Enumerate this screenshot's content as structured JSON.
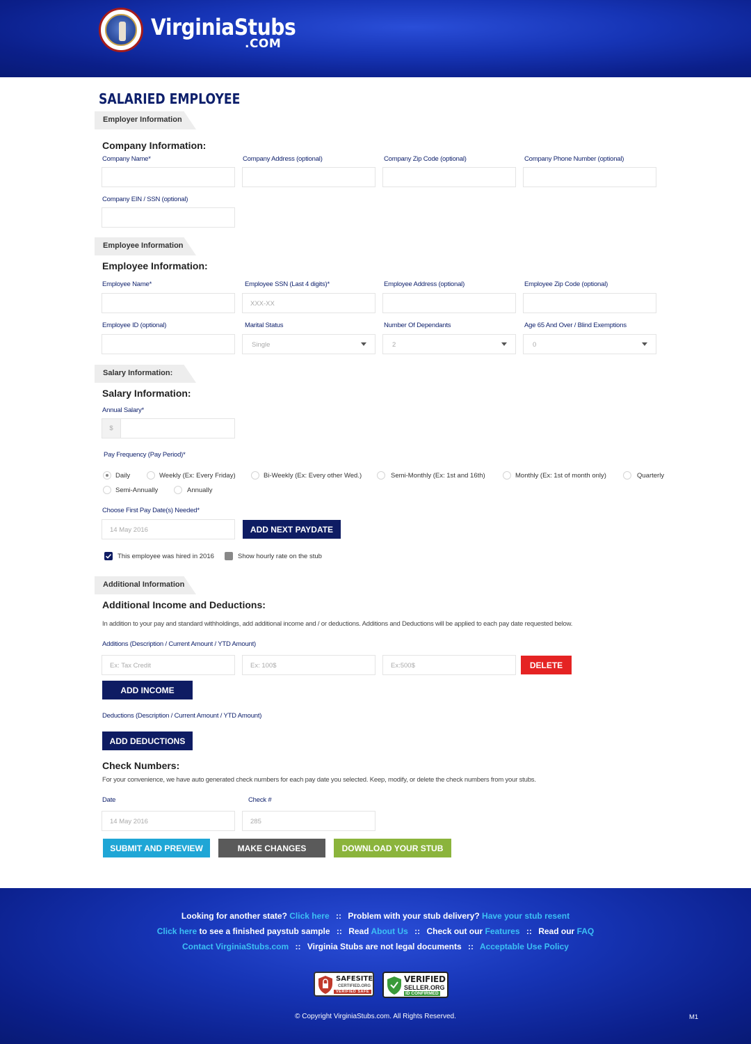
{
  "header": {
    "brand": "VirginiaStubs",
    "brand_suffix": ".COM"
  },
  "page_title": "SALARIED EMPLOYEE",
  "employer": {
    "tab": "Employer Information",
    "heading": "Company Information:",
    "company_name_label": "Company Name*",
    "company_address_label": "Company Address (optional)",
    "company_zip_label": "Company Zip Code (optional)",
    "company_phone_label": "Company Phone Number (optional)",
    "company_ein_label": "Company EIN / SSN (optional)"
  },
  "employee": {
    "tab": "Employee Information",
    "heading": "Employee Information:",
    "name_label": "Employee Name*",
    "ssn_label": "Employee SSN (Last 4 digits)*",
    "ssn_placeholder": "XXX-XX",
    "address_label": "Employee Address (optional)",
    "zip_label": "Employee Zip Code (optional)",
    "id_label": "Employee ID (optional)",
    "marital_label": "Marital Status",
    "marital_value": "Single",
    "dependants_label": "Number Of Dependants",
    "dependants_value": "2",
    "exemptions_label": "Age 65 And Over / Blind Exemptions",
    "exemptions_value": "0"
  },
  "salary": {
    "tab": "Salary Information:",
    "heading": "Salary Information:",
    "annual_label": "Annual Salary*",
    "currency": "$",
    "frequency_label": "Pay Frequency (Pay Period)*",
    "frequencies": [
      "Daily",
      "Weekly (Ex: Every Friday)",
      "Bi-Weekly (Ex: Every other Wed.)",
      "Semi-Monthly (Ex: 1st and 16th)",
      "Monthly (Ex: 1st of month only)",
      "Quarterly",
      "Semi-Annually",
      "Annually"
    ],
    "selected_frequency": "Daily",
    "first_pay_label": "Choose First Pay Date(s) Needed*",
    "first_pay_value": "14 May 2016",
    "add_paydate": "ADD NEXT PAYDATE",
    "hired_checkbox": "This employee was hired in 2016",
    "hired_checked": true,
    "hourly_checkbox": "Show hourly rate on the stub",
    "hourly_checked": false
  },
  "additional": {
    "tab": "Additional Information",
    "heading": "Additional Income and Deductions:",
    "description": "In addition to your pay and standard withholdings, add additional income and / or deductions. Additions and Deductions will be applied to each pay date requested below.",
    "additions_label": "Additions (Description / Current Amount / YTD Amount)",
    "desc_placeholder": "Ex: Tax Credit",
    "current_placeholder": "Ex: 100$",
    "ytd_placeholder": "Ex:500$",
    "delete": "DELETE",
    "add_income": "ADD INCOME",
    "deductions_label": "Deductions (Description / Current Amount / YTD Amount)",
    "add_deductions": "ADD DEDUCTIONS"
  },
  "checks": {
    "heading": "Check Numbers:",
    "description": "For your convenience, we have auto generated check numbers for each pay date you selected. Keep, modify, or delete the check numbers from your stubs.",
    "date_label": "Date",
    "date_value": "14 May 2016",
    "check_label": "Check #",
    "check_value": "285"
  },
  "actions": {
    "submit": "SUBMIT AND PREVIEW",
    "changes": "MAKE CHANGES",
    "download": "DOWNLOAD YOUR STUB",
    "colors": {
      "submit": "#1fa6d6",
      "changes": "#5a5a5a",
      "download": "#8bb43c",
      "delete": "#e52323",
      "navy": "#0e1c63"
    }
  },
  "footer": {
    "l1_text1": "Looking for another state?",
    "l1_link1": "Click here",
    "l1_text2": "Problem with your stub delivery?",
    "l1_link2": "Have your stub resent",
    "l2_link1": "Click here",
    "l2_text1": "to see a finished paystub sample",
    "l2_text2": "Read",
    "l2_link2": "About Us",
    "l2_text3": "Check out our",
    "l2_link3": "Features",
    "l2_text4": "Read our",
    "l2_link4": "FAQ",
    "l3_link1": "Contact VirginiaStubs.com",
    "l3_text1": "Virginia Stubs are not legal documents",
    "l3_link2": "Acceptable Use Policy",
    "separator": "::",
    "badge1_title": "SAFESITE",
    "badge1_sub1": "CERTIFIED.ORG",
    "badge1_sub2": "VERIFIED SAFE",
    "badge2_title": "VERIFIED",
    "badge2_sub1": "SELLER.ORG",
    "badge2_sub2": "ID CONFIRMED",
    "copyright": "© Copyright VirginiaStubs.com. All Rights Reserved.",
    "code": "M1"
  }
}
